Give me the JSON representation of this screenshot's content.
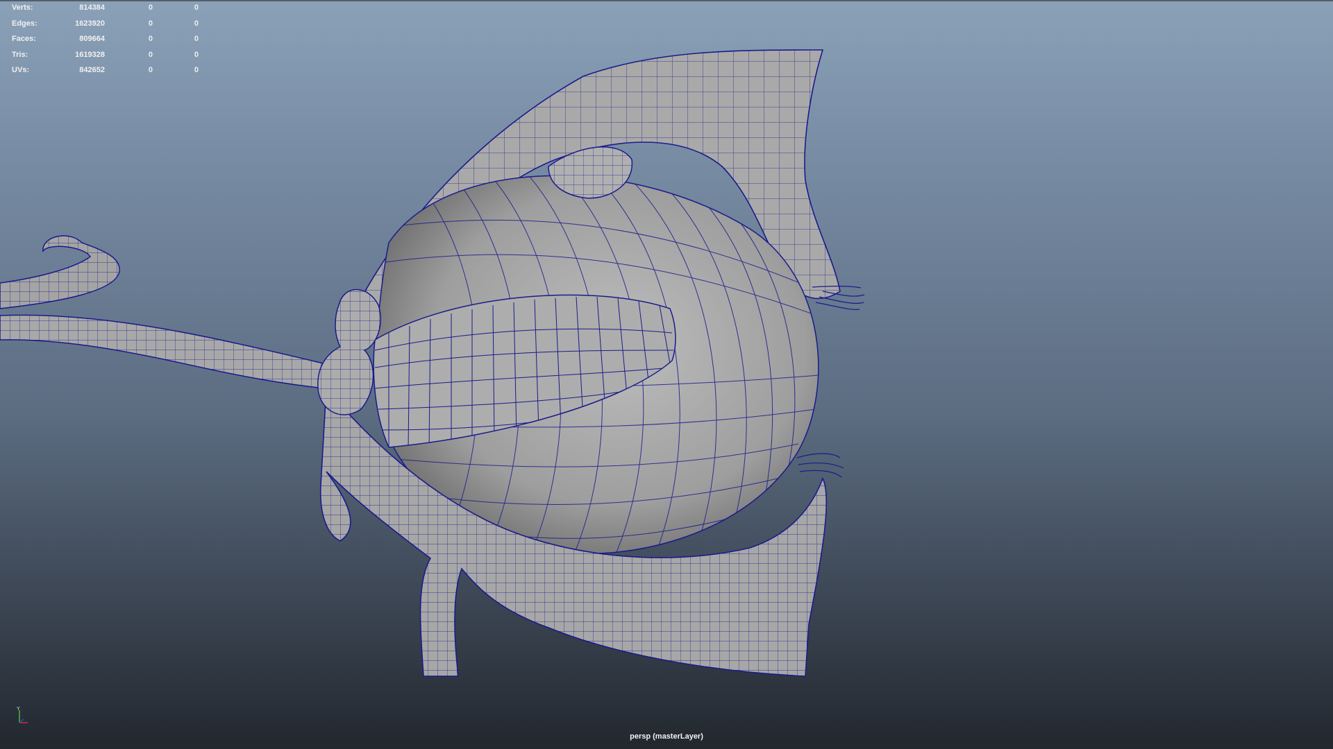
{
  "hud": {
    "stats": [
      {
        "label": "Verts:",
        "value": "814384",
        "sel": "0",
        "uv": "0"
      },
      {
        "label": "Edges:",
        "value": "1623920",
        "sel": "0",
        "uv": "0"
      },
      {
        "label": "Faces:",
        "value": "809664",
        "sel": "0",
        "uv": "0"
      },
      {
        "label": "Tris:",
        "value": "1619328",
        "sel": "0",
        "uv": "0"
      },
      {
        "label": "UVs:",
        "value": "842652",
        "sel": "0",
        "uv": "0"
      }
    ]
  },
  "viewport": {
    "camera_label": "persp (masterLayer)",
    "gizmo_axis_label": "Y"
  },
  "colors": {
    "wireframe": "#1a1a8c",
    "mesh_fill": "#a6a6a6",
    "background_top": "#8aa1b8",
    "background_bottom": "#22272e"
  }
}
